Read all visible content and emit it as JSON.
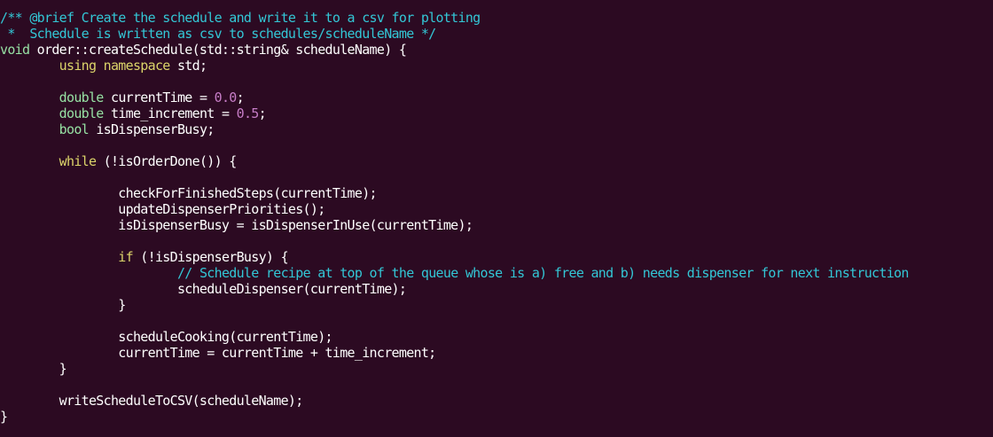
{
  "editor": {
    "lines": [
      [
        {
          "t": "/** @brief Create the schedule and write it to a csv for plotting",
          "c": "cmt"
        }
      ],
      [
        {
          "t": " *  Schedule is written as csv to schedules/scheduleName */",
          "c": "cmt"
        }
      ],
      [
        {
          "t": "void",
          "c": "kw"
        },
        {
          "t": " order::createSchedule(std::string& scheduleName) {",
          "c": "txt"
        }
      ],
      [
        {
          "t": "        ",
          "c": "txt"
        },
        {
          "t": "using namespace",
          "c": "kw2"
        },
        {
          "t": " std;",
          "c": "txt"
        }
      ],
      [],
      [
        {
          "t": "        ",
          "c": "txt"
        },
        {
          "t": "double",
          "c": "kw"
        },
        {
          "t": " currentTime = ",
          "c": "txt"
        },
        {
          "t": "0.0",
          "c": "num"
        },
        {
          "t": ";",
          "c": "txt"
        }
      ],
      [
        {
          "t": "        ",
          "c": "txt"
        },
        {
          "t": "double",
          "c": "kw"
        },
        {
          "t": " time_increment = ",
          "c": "txt"
        },
        {
          "t": "0.5",
          "c": "num"
        },
        {
          "t": ";",
          "c": "txt"
        }
      ],
      [
        {
          "t": "        ",
          "c": "txt"
        },
        {
          "t": "bool",
          "c": "kw"
        },
        {
          "t": " isDispenserBusy;",
          "c": "txt"
        }
      ],
      [],
      [
        {
          "t": "        ",
          "c": "txt"
        },
        {
          "t": "while",
          "c": "kw2"
        },
        {
          "t": " (!isOrderDone()) {",
          "c": "txt"
        }
      ],
      [],
      [
        {
          "t": "                checkForFinishedSteps(currentTime);",
          "c": "txt"
        }
      ],
      [
        {
          "t": "                updateDispenserPriorities();",
          "c": "txt"
        }
      ],
      [
        {
          "t": "                isDispenserBusy = isDispenserInUse(currentTime);",
          "c": "txt"
        }
      ],
      [],
      [
        {
          "t": "                ",
          "c": "txt"
        },
        {
          "t": "if",
          "c": "kw2"
        },
        {
          "t": " (!isDispenserBusy) {",
          "c": "txt"
        }
      ],
      [
        {
          "t": "                        ",
          "c": "txt"
        },
        {
          "t": "// Schedule recipe at top of the queue whose is a) free and b) needs dispenser for next instruction",
          "c": "cmt"
        }
      ],
      [
        {
          "t": "                        scheduleDispenser(currentTime);",
          "c": "txt"
        }
      ],
      [
        {
          "t": "                }",
          "c": "txt"
        }
      ],
      [],
      [
        {
          "t": "                scheduleCooking(currentTime);",
          "c": "txt"
        }
      ],
      [
        {
          "t": "                currentTime = currentTime + time_increment;",
          "c": "txt"
        }
      ],
      [
        {
          "t": "        }",
          "c": "txt"
        }
      ],
      [],
      [
        {
          "t": "        writeScheduleToCSV(scheduleName);",
          "c": "txt"
        }
      ],
      [
        {
          "t": "}",
          "c": "txt"
        }
      ]
    ]
  }
}
